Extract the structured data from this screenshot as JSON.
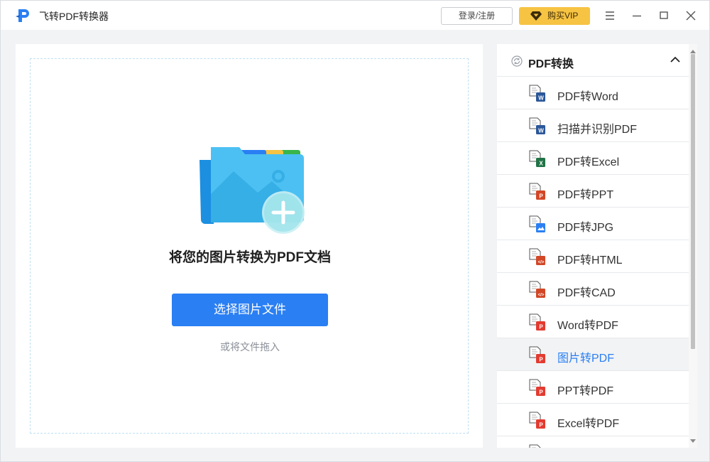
{
  "app": {
    "title": "飞转PDF转换器",
    "login_label": "登录/注册",
    "vip_label": "购买VIP"
  },
  "colors": {
    "accent": "#2a7ff3",
    "vip": "#f6c343",
    "word": "#2b579a",
    "excel": "#217346",
    "ppt": "#d24726",
    "pdf": "#e33b30",
    "image": "#2a7ff3"
  },
  "main": {
    "heading": "将您的图片转换为PDF文档",
    "select_button": "选择图片文件",
    "drag_hint": "或将文件拖入"
  },
  "sidebar": {
    "section_title": "PDF转换",
    "items": [
      {
        "label": "PDF转Word",
        "icon": "word-icon"
      },
      {
        "label": "扫描并识别PDF",
        "icon": "word-icon"
      },
      {
        "label": "PDF转Excel",
        "icon": "excel-icon"
      },
      {
        "label": "PDF转PPT",
        "icon": "ppt-icon"
      },
      {
        "label": "PDF转JPG",
        "icon": "image-icon"
      },
      {
        "label": "PDF转HTML",
        "icon": "code-icon"
      },
      {
        "label": "PDF转CAD",
        "icon": "code-icon"
      },
      {
        "label": "Word转PDF",
        "icon": "pdf-icon"
      },
      {
        "label": "图片转PDF",
        "icon": "pdf-icon",
        "active": true
      },
      {
        "label": "PPT转PDF",
        "icon": "pdf-icon"
      },
      {
        "label": "Excel转PDF",
        "icon": "pdf-icon"
      },
      {
        "label": "",
        "icon": "pdf-icon"
      }
    ]
  }
}
